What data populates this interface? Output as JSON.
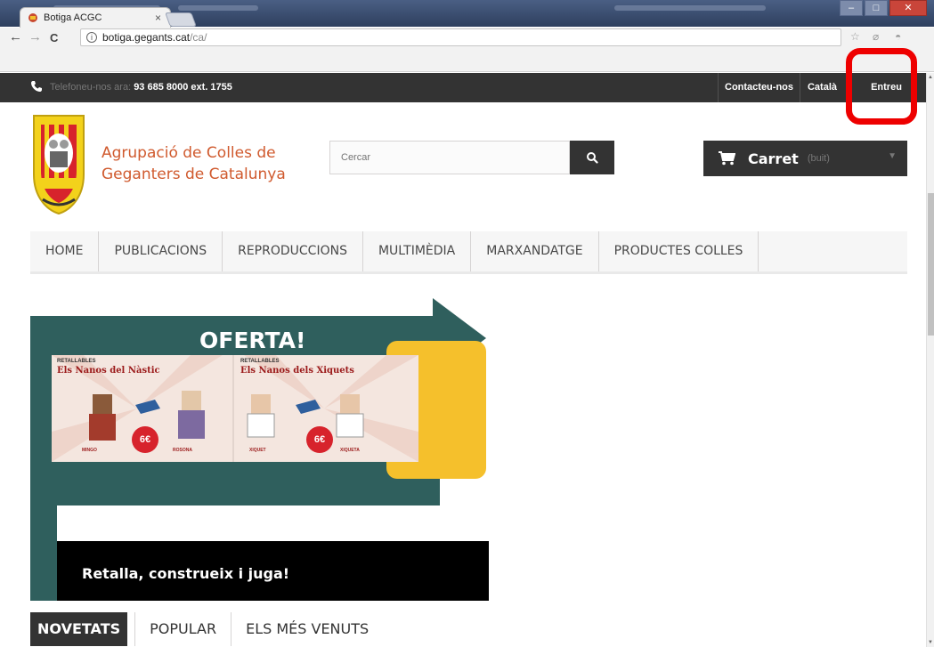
{
  "browser": {
    "tab_title": "Botiga ACGC",
    "tab_close": "×",
    "back": "←",
    "forward": "→",
    "reload": "C",
    "info": "i",
    "url_host": "botiga.gegants.cat",
    "url_path": "/ca/"
  },
  "topbar": {
    "phone_label": "Telefoneu-nos ara:",
    "phone_number": "93 685 8000 ext. 1755",
    "links": [
      "Contacteu-nos",
      "Català",
      "Entreu"
    ]
  },
  "header": {
    "brand_line1": "Agrupació de Colles de",
    "brand_line2": "Geganters de Catalunya",
    "search_placeholder": "Cercar",
    "cart_label": "Carret",
    "cart_status": "(buit)"
  },
  "menu": {
    "items": [
      "HOME",
      "PUBLICACIONS",
      "REPRODUCCIONS",
      "MULTIMÈDIA",
      "MARXANDATGE",
      "PRODUCTES COLLES"
    ]
  },
  "banner": {
    "title": "OFERTA!",
    "caption": "Retalla, construeix i juga!",
    "products": [
      {
        "brand": "RETALLABLES",
        "title": "Els Nanos del Nàstic",
        "price": "6€",
        "left_name": "MINGO",
        "right_name": "ROSONA"
      },
      {
        "brand": "RETALLABLES",
        "title": "Els Nanos dels Xiquets",
        "price": "6€",
        "left_name": "XIQUET",
        "right_name": "XIQUETA"
      }
    ]
  },
  "product_tabs": {
    "items": [
      "NOVETATS",
      "POPULAR",
      "ELS MÉS VENUTS"
    ]
  },
  "colors": {
    "brand": "#d05a2e",
    "dark": "#333333",
    "banner_teal": "#2f5f5d",
    "banner_yellow": "#f5c02c",
    "annotation_red": "#ee0000"
  },
  "icons": [
    "phone-icon",
    "search-icon",
    "cart-icon",
    "info-icon",
    "favicon-icon",
    "star-icon",
    "extension-icon"
  ]
}
